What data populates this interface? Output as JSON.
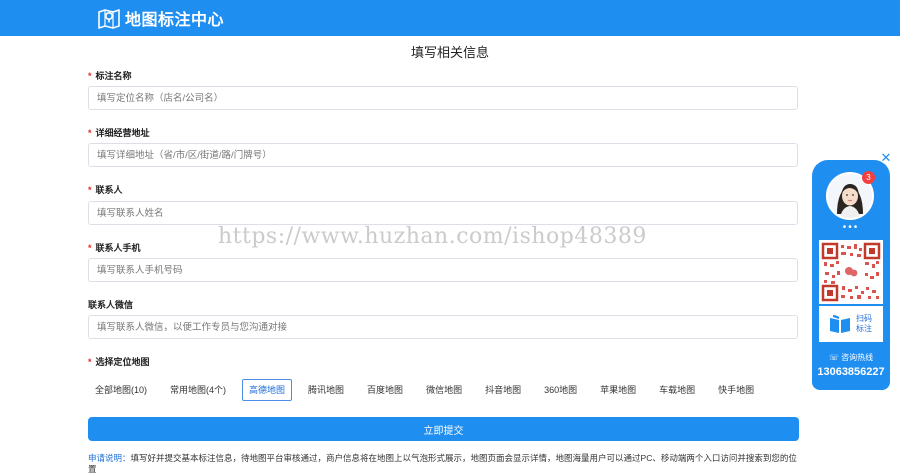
{
  "header": {
    "title": "地图标注中心",
    "logo_icon": "map-pin-icon"
  },
  "form": {
    "heading": "填写相关信息",
    "fields": [
      {
        "label": "标注名称",
        "required": true,
        "placeholder": "填写定位名称（店名/公司名）"
      },
      {
        "label": "详细经营地址",
        "required": true,
        "placeholder": "填写详细地址（省/市/区/街道/路/门牌号）"
      },
      {
        "label": "联系人",
        "required": true,
        "placeholder": "填写联系人姓名"
      },
      {
        "label": "联系人手机",
        "required": true,
        "placeholder": "填写联系人手机号码"
      },
      {
        "label": "联系人微信",
        "required": false,
        "placeholder": "填写联系人微信，以便工作专员与您沟通对接"
      }
    ],
    "map_section": {
      "label": "选择定位地图",
      "required": true,
      "tabs": [
        {
          "label": "全部地图(10)",
          "active": false
        },
        {
          "label": "常用地图(4个)",
          "active": false
        },
        {
          "label": "高德地图",
          "active": true
        },
        {
          "label": "腾讯地图",
          "active": false
        },
        {
          "label": "百度地图",
          "active": false
        },
        {
          "label": "微信地图",
          "active": false
        },
        {
          "label": "抖音地图",
          "active": false
        },
        {
          "label": "360地图",
          "active": false
        },
        {
          "label": "苹果地图",
          "active": false
        },
        {
          "label": "车载地图",
          "active": false
        },
        {
          "label": "快手地图",
          "active": false
        }
      ]
    },
    "submit_label": "立即提交",
    "note_key": "申请说明：",
    "note_text": "填写好并提交基本标注信息，待地图平台审核通过，商户信息将在地图上以气泡形式展示，地图页面会显示详情，地图海量用户可以通过PC、移动端两个入口访问并搜索到您的位置"
  },
  "watermark": "https://www.huzhan.com/ishop48389",
  "service_panel": {
    "badge_count": "3",
    "dots": "•••",
    "qr_sub_label": "扫码标注",
    "hotline_label": "咨询热线",
    "phone": "13063856227",
    "close_icon": "close-icon"
  },
  "colors": {
    "brand": "#1f8ef1",
    "required": "#e02b2b",
    "accent_text": "#1f6fd8"
  }
}
